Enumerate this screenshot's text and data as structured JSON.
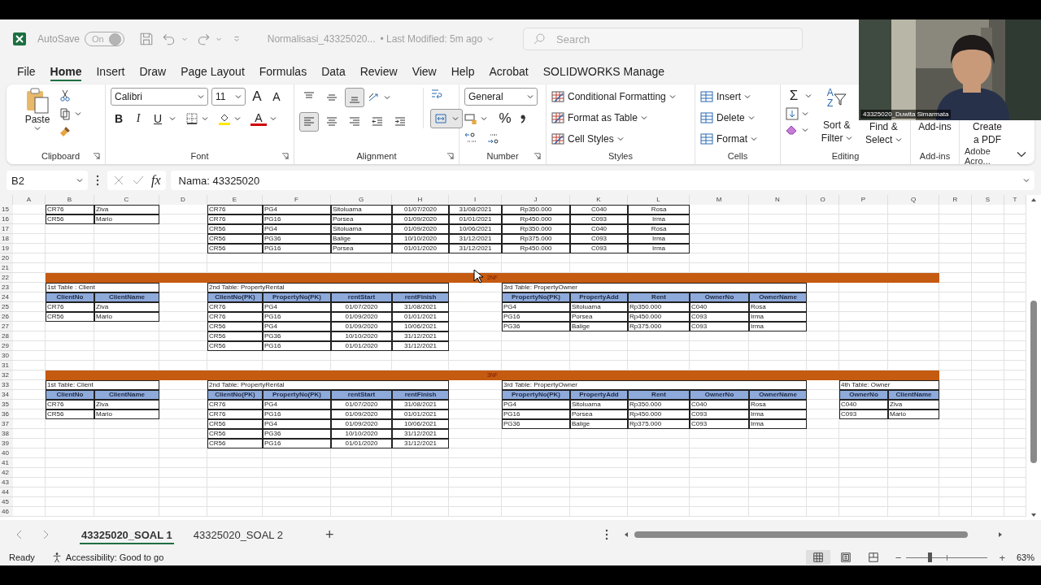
{
  "title_bar": {
    "autosave": "AutoSave",
    "autosave_toggle": {
      "label": "On",
      "on": true
    },
    "document": "Normalisasi_43325020...",
    "modified": "• Last Modified: 5m ago",
    "search": {
      "placeholder": "Search"
    }
  },
  "menu_tabs": [
    {
      "label": "File",
      "selected": false
    },
    {
      "label": "Home",
      "selected": true
    },
    {
      "label": "Insert",
      "selected": false
    },
    {
      "label": "Draw",
      "selected": false
    },
    {
      "label": "Page Layout",
      "selected": false
    },
    {
      "label": "Formulas",
      "selected": false
    },
    {
      "label": "Data",
      "selected": false
    },
    {
      "label": "Review",
      "selected": false
    },
    {
      "label": "View",
      "selected": false
    },
    {
      "label": "Help",
      "selected": false
    },
    {
      "label": "Acrobat",
      "selected": false
    },
    {
      "label": "SOLIDWORKS Manage",
      "selected": false
    }
  ],
  "ribbon": {
    "clipboard": {
      "paste": "Paste",
      "label": "Clipboard"
    },
    "font": {
      "family": "Calibri",
      "size": "11",
      "grow": "A",
      "shrink": "A",
      "bold": "B",
      "italic": "I",
      "underline": "U",
      "font_color": "A",
      "label": "Font"
    },
    "alignment": {
      "vertical": [
        {
          "kind": "top",
          "on": false
        },
        {
          "kind": "middle",
          "on": false
        },
        {
          "kind": "bottom",
          "on": true
        }
      ],
      "horizontal": [
        {
          "kind": "left",
          "on": true
        },
        {
          "kind": "center",
          "on": false
        },
        {
          "kind": "right",
          "on": false
        },
        {
          "kind": "outdent",
          "on": false
        },
        {
          "kind": "indent",
          "on": false
        }
      ],
      "merge_on": true,
      "label": "Alignment"
    },
    "number": {
      "format": "General",
      "percent": "%",
      "label": "Number"
    },
    "styles": {
      "items": [
        "Conditional Formatting",
        "Format as Table",
        "Cell Styles"
      ],
      "label": "Styles"
    },
    "cells": {
      "items": [
        "Insert",
        "Delete",
        "Format"
      ],
      "label": "Cells"
    },
    "editing": {
      "sum": "Σ",
      "sort_letters": [
        "A",
        "Z"
      ],
      "sort": [
        "Sort &",
        "Filter"
      ],
      "find": [
        "Find &",
        "Select"
      ],
      "label": "Editing"
    },
    "addins": {
      "button": "Add-ins",
      "label": "Add-ins"
    },
    "adobe": {
      "button": [
        "Create",
        "a PDF"
      ],
      "label": "Adobe Acro..."
    }
  },
  "formula_bar": {
    "name_box": "B2",
    "fx": "fx",
    "formula": "Nama: 43325020"
  },
  "sheet": {
    "columns": [
      "A",
      "B",
      "C",
      "D",
      "E",
      "F",
      "G",
      "H",
      "I",
      "J",
      "K",
      "L",
      "M",
      "N",
      "O",
      "P",
      "Q",
      "R",
      "S",
      "T"
    ],
    "rows": [
      {
        "number": "15",
        "cells": [
          null,
          {
            "kind": "left",
            "text": "CR76"
          },
          {
            "kind": "left",
            "text": "Ziva"
          },
          null,
          {
            "kind": "left",
            "text": "CR76"
          },
          {
            "kind": "left",
            "text": "PG4"
          },
          {
            "kind": "left",
            "text": "Sitoluama"
          },
          {
            "kind": "center",
            "text": "01/07/2020"
          },
          {
            "kind": "center",
            "text": "31/08/2021"
          },
          {
            "kind": "center",
            "text": "Rp350.000"
          },
          {
            "kind": "center",
            "text": "C040"
          },
          {
            "kind": "center",
            "text": "Rosa"
          }
        ]
      },
      {
        "number": "16",
        "cells": [
          null,
          {
            "kind": "left",
            "text": "CR56"
          },
          {
            "kind": "left",
            "text": "Mario"
          },
          null,
          {
            "kind": "left",
            "text": "CR76"
          },
          {
            "kind": "left",
            "text": "PG16"
          },
          {
            "kind": "left",
            "text": "Porsea"
          },
          {
            "kind": "center",
            "text": "01/09/2020"
          },
          {
            "kind": "center",
            "text": "01/01/2021"
          },
          {
            "kind": "center",
            "text": "Rp450.000"
          },
          {
            "kind": "center",
            "text": "C093"
          },
          {
            "kind": "center",
            "text": "Irma"
          }
        ]
      },
      {
        "number": "17",
        "cells": [
          null,
          null,
          null,
          null,
          {
            "kind": "left",
            "text": "CR56"
          },
          {
            "kind": "left",
            "text": "PG4"
          },
          {
            "kind": "left",
            "text": "Sitoluama"
          },
          {
            "kind": "center",
            "text": "01/09/2020"
          },
          {
            "kind": "center",
            "text": "10/06/2021"
          },
          {
            "kind": "center",
            "text": "Rp350.000"
          },
          {
            "kind": "center",
            "text": "C040"
          },
          {
            "kind": "center",
            "text": "Rosa"
          }
        ]
      },
      {
        "number": "18",
        "cells": [
          null,
          null,
          null,
          null,
          {
            "kind": "left",
            "text": "CR56"
          },
          {
            "kind": "left",
            "text": "PG36"
          },
          {
            "kind": "left",
            "text": "Balige"
          },
          {
            "kind": "center",
            "text": "10/10/2020"
          },
          {
            "kind": "center",
            "text": "31/12/2021"
          },
          {
            "kind": "center",
            "text": "Rp375.000"
          },
          {
            "kind": "center",
            "text": "C093"
          },
          {
            "kind": "center",
            "text": "Irma"
          }
        ]
      },
      {
        "number": "19",
        "cells": [
          null,
          null,
          null,
          null,
          {
            "kind": "left",
            "text": "CR56"
          },
          {
            "kind": "left",
            "text": "PG16"
          },
          {
            "kind": "left",
            "text": "Porsea"
          },
          {
            "kind": "center",
            "text": "01/01/2020"
          },
          {
            "kind": "center",
            "text": "31/12/2021"
          },
          {
            "kind": "center",
            "text": "Rp450.000"
          },
          {
            "kind": "center",
            "text": "C093"
          },
          {
            "kind": "center",
            "text": "Irma"
          }
        ]
      },
      {
        "number": "20"
      },
      {
        "number": "21"
      },
      {
        "number": "22",
        "cells": [
          null,
          {
            "kind": "band",
            "text": "2NF"
          },
          {
            "kind": "merged"
          },
          {
            "kind": "merged"
          },
          {
            "kind": "merged"
          },
          {
            "kind": "merged"
          },
          {
            "kind": "merged"
          },
          {
            "kind": "merged"
          },
          {
            "kind": "merged"
          },
          {
            "kind": "merged"
          },
          {
            "kind": "merged"
          },
          {
            "kind": "merged"
          },
          {
            "kind": "merged"
          },
          {
            "kind": "merged"
          },
          {
            "kind": "merged"
          },
          {
            "kind": "merged"
          },
          {
            "kind": "merged"
          }
        ]
      },
      {
        "number": "23",
        "cells": [
          null,
          {
            "kind": "title",
            "text": "1st Table : Client"
          },
          {
            "kind": "merged"
          },
          null,
          {
            "kind": "title",
            "text": "2nd Table: PropertyRental"
          },
          {
            "kind": "merged"
          },
          {
            "kind": "merged"
          },
          {
            "kind": "merged"
          },
          null,
          {
            "kind": "title",
            "text": "3rd Table: PropertyOwner"
          },
          {
            "kind": "merged"
          },
          {
            "kind": "merged"
          },
          {
            "kind": "merged"
          },
          {
            "kind": "merged"
          }
        ]
      },
      {
        "number": "24",
        "cells": [
          null,
          {
            "kind": "head",
            "text": "ClientNo"
          },
          {
            "kind": "head",
            "text": "ClientName"
          },
          null,
          {
            "kind": "head",
            "text": "ClientNo(PK)"
          },
          {
            "kind": "head",
            "text": "PropertyNo(PK)"
          },
          {
            "kind": "head",
            "text": "rentStart"
          },
          {
            "kind": "head",
            "text": "rentFinish"
          },
          null,
          {
            "kind": "head",
            "text": "PropertyNo(PK)"
          },
          {
            "kind": "head",
            "text": "PropertyAdd"
          },
          {
            "kind": "head",
            "text": "Rent"
          },
          {
            "kind": "head",
            "text": "OwnerNo"
          },
          {
            "kind": "head",
            "text": "OwnerName"
          }
        ]
      },
      {
        "number": "25",
        "cells": [
          null,
          {
            "kind": "left",
            "text": "CR76"
          },
          {
            "kind": "left",
            "text": "Ziva"
          },
          null,
          {
            "kind": "left",
            "text": "CR76"
          },
          {
            "kind": "left",
            "text": "PG4"
          },
          {
            "kind": "center",
            "text": "01/07/2020"
          },
          {
            "kind": "center",
            "text": "31/08/2021"
          },
          null,
          {
            "kind": "left",
            "text": "PG4"
          },
          {
            "kind": "left",
            "text": "Sitoluama"
          },
          {
            "kind": "left",
            "text": "Rp350.000"
          },
          {
            "kind": "left",
            "text": "C040"
          },
          {
            "kind": "left",
            "text": "Rosa"
          }
        ]
      },
      {
        "number": "26",
        "cells": [
          null,
          {
            "kind": "left",
            "text": "CR56"
          },
          {
            "kind": "left",
            "text": "Mario"
          },
          null,
          {
            "kind": "left",
            "text": "CR76"
          },
          {
            "kind": "left",
            "text": "PG16"
          },
          {
            "kind": "center",
            "text": "01/09/2020"
          },
          {
            "kind": "center",
            "text": "01/01/2021"
          },
          null,
          {
            "kind": "left",
            "text": "PG16"
          },
          {
            "kind": "left",
            "text": "Porsea"
          },
          {
            "kind": "left",
            "text": "Rp450.000"
          },
          {
            "kind": "left",
            "text": "C093"
          },
          {
            "kind": "left",
            "text": "Irma"
          }
        ]
      },
      {
        "number": "27",
        "cells": [
          null,
          null,
          null,
          null,
          {
            "kind": "left",
            "text": "CR56"
          },
          {
            "kind": "left",
            "text": "PG4"
          },
          {
            "kind": "center",
            "text": "01/09/2020"
          },
          {
            "kind": "center",
            "text": "10/06/2021"
          },
          null,
          {
            "kind": "left",
            "text": "PG36"
          },
          {
            "kind": "left",
            "text": "Balige"
          },
          {
            "kind": "left",
            "text": "Rp375.000"
          },
          {
            "kind": "left",
            "text": "C093"
          },
          {
            "kind": "left",
            "text": "Irma"
          }
        ]
      },
      {
        "number": "28",
        "cells": [
          null,
          null,
          null,
          null,
          {
            "kind": "left",
            "text": "CR56"
          },
          {
            "kind": "left",
            "text": "PG36"
          },
          {
            "kind": "center",
            "text": "10/10/2020"
          },
          {
            "kind": "center",
            "text": "31/12/2021"
          }
        ]
      },
      {
        "number": "29",
        "cells": [
          null,
          null,
          null,
          null,
          {
            "kind": "left",
            "text": "CR56"
          },
          {
            "kind": "left",
            "text": "PG16"
          },
          {
            "kind": "center",
            "text": "01/01/2020"
          },
          {
            "kind": "center",
            "text": "31/12/2021"
          }
        ]
      },
      {
        "number": "30"
      },
      {
        "number": "31"
      },
      {
        "number": "32",
        "cells": [
          null,
          {
            "kind": "band",
            "text": "3NF"
          },
          {
            "kind": "merged"
          },
          {
            "kind": "merged"
          },
          {
            "kind": "merged"
          },
          {
            "kind": "merged"
          },
          {
            "kind": "merged"
          },
          {
            "kind": "merged"
          },
          {
            "kind": "merged"
          },
          {
            "kind": "merged"
          },
          {
            "kind": "merged"
          },
          {
            "kind": "merged"
          },
          {
            "kind": "merged"
          },
          {
            "kind": "merged"
          },
          {
            "kind": "merged"
          },
          {
            "kind": "merged"
          },
          {
            "kind": "merged"
          }
        ]
      },
      {
        "number": "33",
        "cells": [
          null,
          {
            "kind": "title",
            "text": "1st Table: Client"
          },
          {
            "kind": "merged"
          },
          null,
          {
            "kind": "title",
            "text": "2nd Table: PropertyRental"
          },
          {
            "kind": "merged"
          },
          {
            "kind": "merged"
          },
          {
            "kind": "merged"
          },
          null,
          {
            "kind": "title",
            "text": "3rd Table: PropertyOwner"
          },
          {
            "kind": "merged"
          },
          {
            "kind": "merged"
          },
          {
            "kind": "merged"
          },
          {
            "kind": "merged"
          },
          null,
          {
            "kind": "title",
            "text": "4th Table: Owner"
          },
          {
            "kind": "merged"
          }
        ]
      },
      {
        "number": "34",
        "cells": [
          null,
          {
            "kind": "head",
            "text": "ClientNo"
          },
          {
            "kind": "head",
            "text": "ClientName"
          },
          null,
          {
            "kind": "head",
            "text": "ClientNo(PK)"
          },
          {
            "kind": "head",
            "text": "PropertyNo(PK)"
          },
          {
            "kind": "head",
            "text": "rentStart"
          },
          {
            "kind": "head",
            "text": "rentFinish"
          },
          null,
          {
            "kind": "head",
            "text": "PropertyNo(PK)"
          },
          {
            "kind": "head",
            "text": "PropertyAdd"
          },
          {
            "kind": "head",
            "text": "Rent"
          },
          {
            "kind": "head",
            "text": "OwnerNo"
          },
          {
            "kind": "head",
            "text": "OwnerName"
          },
          null,
          {
            "kind": "head",
            "text": "OwnerNo"
          },
          {
            "kind": "head",
            "text": "ClientName"
          }
        ]
      },
      {
        "number": "35",
        "cells": [
          null,
          {
            "kind": "left",
            "text": "CR76"
          },
          {
            "kind": "left",
            "text": "Ziva"
          },
          null,
          {
            "kind": "left",
            "text": "CR76"
          },
          {
            "kind": "left",
            "text": "PG4"
          },
          {
            "kind": "center",
            "text": "01/07/2020"
          },
          {
            "kind": "center",
            "text": "31/08/2021"
          },
          null,
          {
            "kind": "left",
            "text": "PG4"
          },
          {
            "kind": "left",
            "text": "Sitoluama"
          },
          {
            "kind": "left",
            "text": "Rp350.000"
          },
          {
            "kind": "left",
            "text": "C040"
          },
          {
            "kind": "left",
            "text": "Rosa"
          },
          null,
          {
            "kind": "left",
            "text": "C040"
          },
          {
            "kind": "left",
            "text": "Ziva"
          }
        ]
      },
      {
        "number": "36",
        "cells": [
          null,
          {
            "kind": "left",
            "text": "CR56"
          },
          {
            "kind": "left",
            "text": "Mario"
          },
          null,
          {
            "kind": "left",
            "text": "CR76"
          },
          {
            "kind": "left",
            "text": "PG16"
          },
          {
            "kind": "center",
            "text": "01/09/2020"
          },
          {
            "kind": "center",
            "text": "01/01/2021"
          },
          null,
          {
            "kind": "left",
            "text": "PG16"
          },
          {
            "kind": "left",
            "text": "Porsea"
          },
          {
            "kind": "left",
            "text": "Rp450.000"
          },
          {
            "kind": "left",
            "text": "C093"
          },
          {
            "kind": "left",
            "text": "Irma"
          },
          null,
          {
            "kind": "left",
            "text": "C093"
          },
          {
            "kind": "left",
            "text": "Mario"
          }
        ]
      },
      {
        "number": "37",
        "cells": [
          null,
          null,
          null,
          null,
          {
            "kind": "left",
            "text": "CR56"
          },
          {
            "kind": "left",
            "text": "PG4"
          },
          {
            "kind": "center",
            "text": "01/09/2020"
          },
          {
            "kind": "center",
            "text": "10/06/2021"
          },
          null,
          {
            "kind": "left",
            "text": "PG36"
          },
          {
            "kind": "left",
            "text": "Balige"
          },
          {
            "kind": "left",
            "text": "Rp375.000"
          },
          {
            "kind": "left",
            "text": "C093"
          },
          {
            "kind": "left",
            "text": "Irma"
          }
        ]
      },
      {
        "number": "38",
        "cells": [
          null,
          null,
          null,
          null,
          {
            "kind": "left",
            "text": "CR56"
          },
          {
            "kind": "left",
            "text": "PG36"
          },
          {
            "kind": "center",
            "text": "10/10/2020"
          },
          {
            "kind": "center",
            "text": "31/12/2021"
          }
        ]
      },
      {
        "number": "39",
        "cells": [
          null,
          null,
          null,
          null,
          {
            "kind": "left",
            "text": "CR56"
          },
          {
            "kind": "left",
            "text": "PG16"
          },
          {
            "kind": "center",
            "text": "01/01/2020"
          },
          {
            "kind": "center",
            "text": "31/12/2021"
          }
        ]
      },
      {
        "number": "40"
      },
      {
        "number": "41"
      },
      {
        "number": "42"
      },
      {
        "number": "43"
      },
      {
        "number": "44"
      },
      {
        "number": "45"
      },
      {
        "number": "46"
      }
    ]
  },
  "sheet_tabs": [
    {
      "label": "43325020_SOAL 1",
      "selected": true
    },
    {
      "label": "43325020_SOAL 2",
      "selected": false
    }
  ],
  "add_sheet": "+",
  "status_bar": {
    "ready": "Ready",
    "accessibility": "Accessibility: Good to go",
    "views": [
      {
        "kind": "normal",
        "selected": true
      },
      {
        "kind": "layout",
        "selected": false
      },
      {
        "kind": "break",
        "selected": false
      }
    ],
    "zoom_out": "−",
    "zoom_in": "+",
    "zoom": {
      "level": 0.29,
      "reading": "63%"
    }
  },
  "video_call": {
    "participant": "43325020_Duwita Simarmata"
  }
}
